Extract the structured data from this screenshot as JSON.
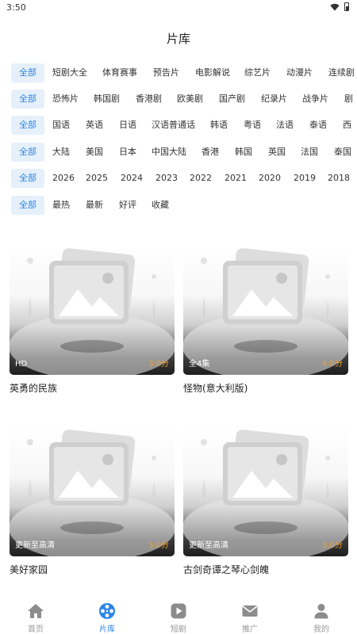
{
  "status_bar": {
    "time": "3:50",
    "icons": [
      "wifi-icon",
      "battery-icon"
    ]
  },
  "header": {
    "title": "片库"
  },
  "filters": [
    [
      "全部",
      "短剧大全",
      "体育赛事",
      "预告片",
      "电影解说",
      "综艺片",
      "动漫片",
      "连续剧"
    ],
    [
      "全部",
      "恐怖片",
      "韩国剧",
      "香港剧",
      "欧美剧",
      "国产剧",
      "纪录片",
      "战争片",
      "剧"
    ],
    [
      "全部",
      "国语",
      "英语",
      "日语",
      "汉语普通话",
      "韩语",
      "粤语",
      "法语",
      "泰语",
      "西"
    ],
    [
      "全部",
      "大陆",
      "美国",
      "日本",
      "中国大陆",
      "香港",
      "韩国",
      "英国",
      "法国",
      "泰国"
    ],
    [
      "全部",
      "2026",
      "2025",
      "2024",
      "2023",
      "2022",
      "2021",
      "2020",
      "2019",
      "2018"
    ],
    [
      "全部",
      "最热",
      "最新",
      "好评",
      "收藏"
    ]
  ],
  "cards": [
    {
      "badge": "HD",
      "score": "3.0分",
      "title": "英勇的民族"
    },
    {
      "badge": "全4集",
      "score": "4.0分",
      "title": "怪物(意大利版)"
    },
    {
      "badge": "更新至高清",
      "score": "3.0分",
      "title": "美好家园"
    },
    {
      "badge": "更新至高清",
      "score": "3.0分",
      "title": "古剑奇谭之琴心剑魄"
    }
  ],
  "tabs": [
    {
      "label": "首页",
      "icon": "home-icon",
      "active": false
    },
    {
      "label": "片库",
      "icon": "film-reel-icon",
      "active": true
    },
    {
      "label": "短剧",
      "icon": "play-icon",
      "active": false
    },
    {
      "label": "推广",
      "icon": "mail-icon",
      "active": false
    },
    {
      "label": "我的",
      "icon": "user-icon",
      "active": false
    }
  ],
  "colors": {
    "accent": "#2b85e4",
    "chip_active_bg": "#e6f0fb",
    "score": "#f0a030",
    "tab_inactive": "#999999"
  }
}
